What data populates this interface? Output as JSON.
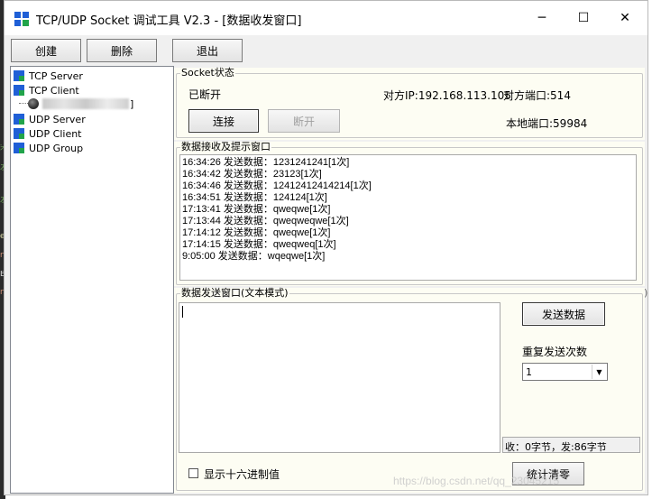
{
  "window": {
    "title": "TCP/UDP Socket 调试工具 V2.3 - [数据收发窗口]",
    "minimize_glyph": "─",
    "maximize_glyph": "☐",
    "close_glyph": "✕"
  },
  "toolbar": {
    "create_label": "创建",
    "delete_label": "删除",
    "exit_label": "退出"
  },
  "tree": {
    "items": [
      {
        "label": "TCP Server"
      },
      {
        "label": "TCP Client"
      },
      {
        "label": "UDP Server"
      },
      {
        "label": "UDP Client"
      },
      {
        "label": "UDP Group"
      }
    ],
    "child_suffix": "]"
  },
  "socket_status": {
    "legend": "Socket状态",
    "state": "已断开",
    "remote_ip": "对方IP:192.168.113.105",
    "remote_port": "对方端口:514",
    "local_port": "本地端口:59984",
    "connect_label": "连接",
    "disconnect_label": "断开"
  },
  "receive": {
    "legend": "数据接收及提示窗口",
    "lines": [
      "16:34:26 发送数据：1231241241[1次]",
      "16:34:42 发送数据：23123[1次]",
      "16:34:46 发送数据：12412412414214[1次]",
      "16:34:51 发送数据：124124[1次]",
      "17:13:41 发送数据：qweqwe[1次]",
      "17:13:44 发送数据：qweqweqwe[1次]",
      "17:14:12 发送数据：qweqwe[1次]",
      "17:14:15 发送数据：qweqweq[1次]",
      "9:05:00 发送数据：wqeqwe[1次]"
    ]
  },
  "send": {
    "legend": "数据发送窗口(文本模式)",
    "input_value": "",
    "send_label": "发送数据",
    "repeat_label": "重复发送次数",
    "repeat_value": "1",
    "counter": "收：0字节，发:86字节",
    "hex_label": "显示十六进制值",
    "clear_label": "统计清零"
  },
  "watermark": "https://blog.csdn.net/qq_23045215",
  "colors": {
    "group_bg": "#fdfdf3",
    "icon_blue": "#1f5fd6",
    "icon_green": "#21a44a"
  }
}
